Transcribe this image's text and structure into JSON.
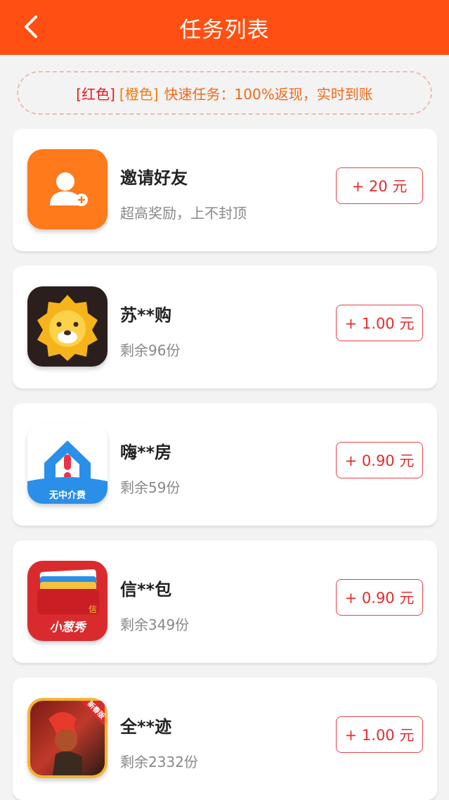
{
  "header": {
    "title": "任务列表",
    "back_icon": "chevron-left-icon"
  },
  "notice": {
    "red_tag": "[红色]",
    "orange_tag": "[橙色]",
    "text": "快速任务：100%返现，实时到账"
  },
  "tasks": [
    {
      "title": "邀请好友",
      "subtitle": "超高奖励，上不封顶",
      "reward": "+ 20 元",
      "icon": "invite-friend-icon"
    },
    {
      "title": "苏**购",
      "subtitle": "剩余96份",
      "reward": "+ 1.00 元",
      "icon": "lion-app-icon"
    },
    {
      "title": "嗨**房",
      "subtitle": "剩余59份",
      "reward": "+ 0.90 元",
      "icon": "house-app-icon",
      "icon_caption": "无中介费"
    },
    {
      "title": "信**包",
      "subtitle": "剩余349份",
      "reward": "+ 0.90 元",
      "icon": "wallet-app-icon",
      "icon_caption": "小葱秀",
      "icon_side_char": "信"
    },
    {
      "title": "全**迹",
      "subtitle": "剩余2332份",
      "reward": "+ 1.00 元",
      "icon": "game-app-icon",
      "icon_badge": "新春版"
    }
  ]
}
